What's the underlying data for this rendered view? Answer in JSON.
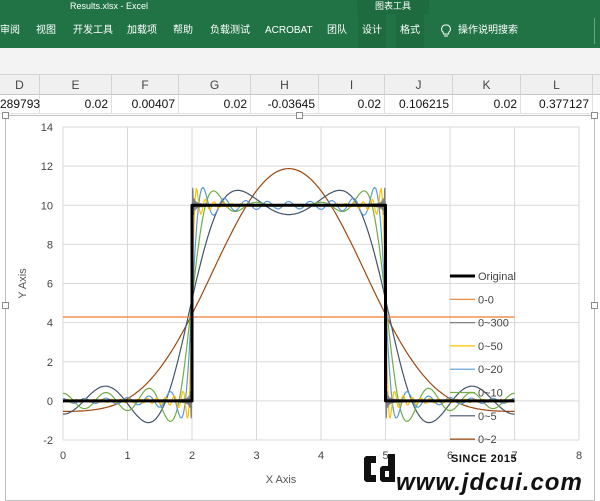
{
  "window": {
    "title": "Results.xlsx  -  Excel",
    "context_group": "图表工具"
  },
  "ribbon": {
    "tabs": [
      "审阅",
      "视图",
      "开发工具",
      "加载项",
      "帮助",
      "负载测试",
      "ACROBAT",
      "团队",
      "设计",
      "格式"
    ],
    "tell_me": "操作说明搜索"
  },
  "sheet": {
    "columns": [
      "D",
      "E",
      "F",
      "G",
      "H",
      "I",
      "J",
      "K",
      "L"
    ],
    "row": [
      "289793",
      "0.02",
      "0.00407",
      "0.02",
      "-0.03645",
      "0.02",
      "0.106215",
      "0.02",
      "0.377127"
    ]
  },
  "chart_data": {
    "type": "line",
    "xlabel": "X Axis",
    "ylabel": "Y Axis",
    "xlim": [
      0,
      8
    ],
    "ylim": [
      -2,
      14
    ],
    "xticks": [
      0,
      1,
      2,
      3,
      4,
      5,
      6,
      7,
      8
    ],
    "yticks": [
      -2,
      0,
      2,
      4,
      6,
      8,
      10,
      12,
      14
    ],
    "grid": true,
    "legend_position": "right",
    "signal": {
      "low": 0,
      "high": 10,
      "rise_x": 2,
      "fall_x": 5,
      "x_range": [
        0,
        7
      ]
    },
    "series": [
      {
        "name": "Original",
        "color": "#000000",
        "harmonics": null
      },
      {
        "name": "0-0",
        "color": "#ed7d31",
        "harmonics": 0
      },
      {
        "name": "0~300",
        "color": "#7f7f7f",
        "harmonics": 300
      },
      {
        "name": "0~50",
        "color": "#ffc000",
        "harmonics": 50
      },
      {
        "name": "0~20",
        "color": "#5b9bd5",
        "harmonics": 20
      },
      {
        "name": "0~10",
        "color": "#70ad47",
        "harmonics": 10
      },
      {
        "name": "0~5",
        "color": "#44546a",
        "harmonics": 5
      },
      {
        "name": "0~2",
        "color": "#9e480e",
        "harmonics": 2
      }
    ]
  },
  "watermark": {
    "since": "SINCE 2015",
    "site": "www.jdcui.com"
  }
}
